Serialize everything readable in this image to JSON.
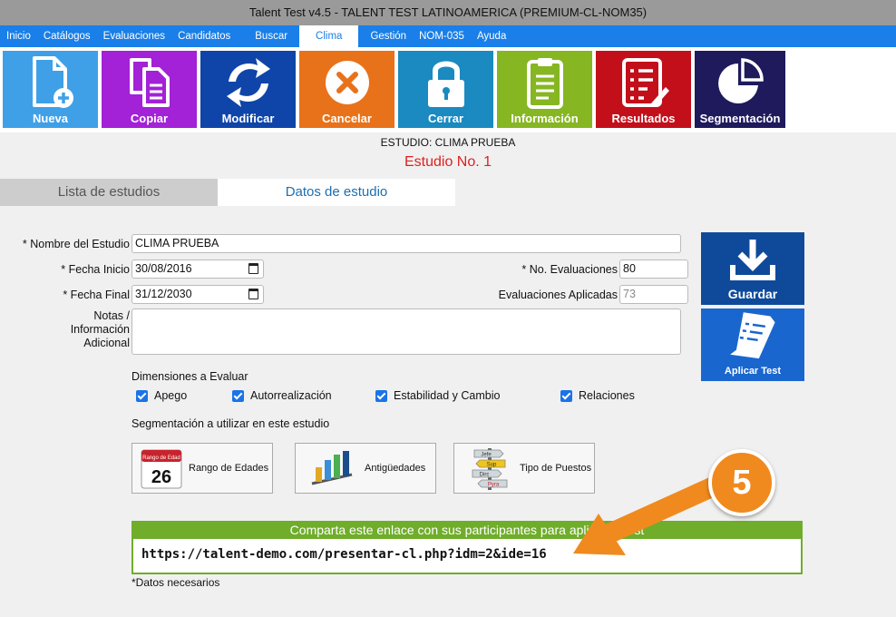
{
  "window": {
    "title": "Talent Test v4.5 - TALENT TEST LATINOAMERICA (PREMIUM-CL-NOM35)"
  },
  "menu": {
    "items": [
      "Inicio",
      "Catálogos",
      "Evaluaciones",
      "Candidatos",
      "Buscar",
      "Clima",
      "Gestión",
      "NOM-035",
      "Ayuda"
    ],
    "active": "Clima"
  },
  "toolbar": {
    "nueva": "Nueva",
    "copiar": "Copiar",
    "modificar": "Modificar",
    "cancelar": "Cancelar",
    "cerrar": "Cerrar",
    "informacion": "Información",
    "resultados": "Resultados",
    "segmentacion": "Segmentación"
  },
  "study": {
    "header": "ESTUDIO: CLIMA PRUEBA",
    "number": "Estudio No. 1"
  },
  "tabs": {
    "list": "Lista de estudios",
    "data": "Datos de estudio"
  },
  "form": {
    "name_label": "* Nombre del Estudio",
    "name_value": "CLIMA PRUEBA",
    "start_label": "* Fecha Inicio",
    "start_value": "30/08/2016",
    "end_label": "* Fecha Final",
    "end_value": "31/12/2030",
    "evals_label": "* No. Evaluaciones",
    "evals_value": "80",
    "applied_label": "Evaluaciones Aplicadas",
    "applied_value": "73",
    "notes_label_1": "Notas /",
    "notes_label_2": "Información",
    "notes_label_3": "Adicional",
    "notes_value": ""
  },
  "actions": {
    "save": "Guardar",
    "apply": "Aplicar Test"
  },
  "dimensions": {
    "title": "Dimensiones a Evaluar",
    "items": [
      "Apego",
      "Autorrealización",
      "Estabilidad y Cambio",
      "Relaciones"
    ]
  },
  "segmentation": {
    "title": "Segmentación a utilizar en este estudio",
    "buttons": [
      "Rango de Edades",
      "Antigüedades",
      "Tipo de Puestos"
    ],
    "calendar_caption": "Rango de Edad",
    "calendar_day": "26",
    "signs": [
      "Jefe",
      "Sup",
      "Dirc",
      "Pyra"
    ]
  },
  "share": {
    "header": "Comparta este enlace con sus participantes para aplicar el test",
    "link": "https://talent-demo.com/presentar-cl.php?idm=2&ide=16"
  },
  "note": "*Datos necesarios",
  "annotation": {
    "step": "5"
  },
  "colors": {
    "nueva": "#3fa0e8",
    "copiar": "#a321d6",
    "modificar": "#0f45a8",
    "cancelar": "#e8721a",
    "cerrar": "#1a8ac0",
    "informacion": "#86b622",
    "resultados": "#c20f1a",
    "segmentacion": "#1e1a5c",
    "menu": "#1a7fe8",
    "share": "#6fad2b",
    "side": "#1a66cf",
    "annotation": "#f08a1e"
  }
}
